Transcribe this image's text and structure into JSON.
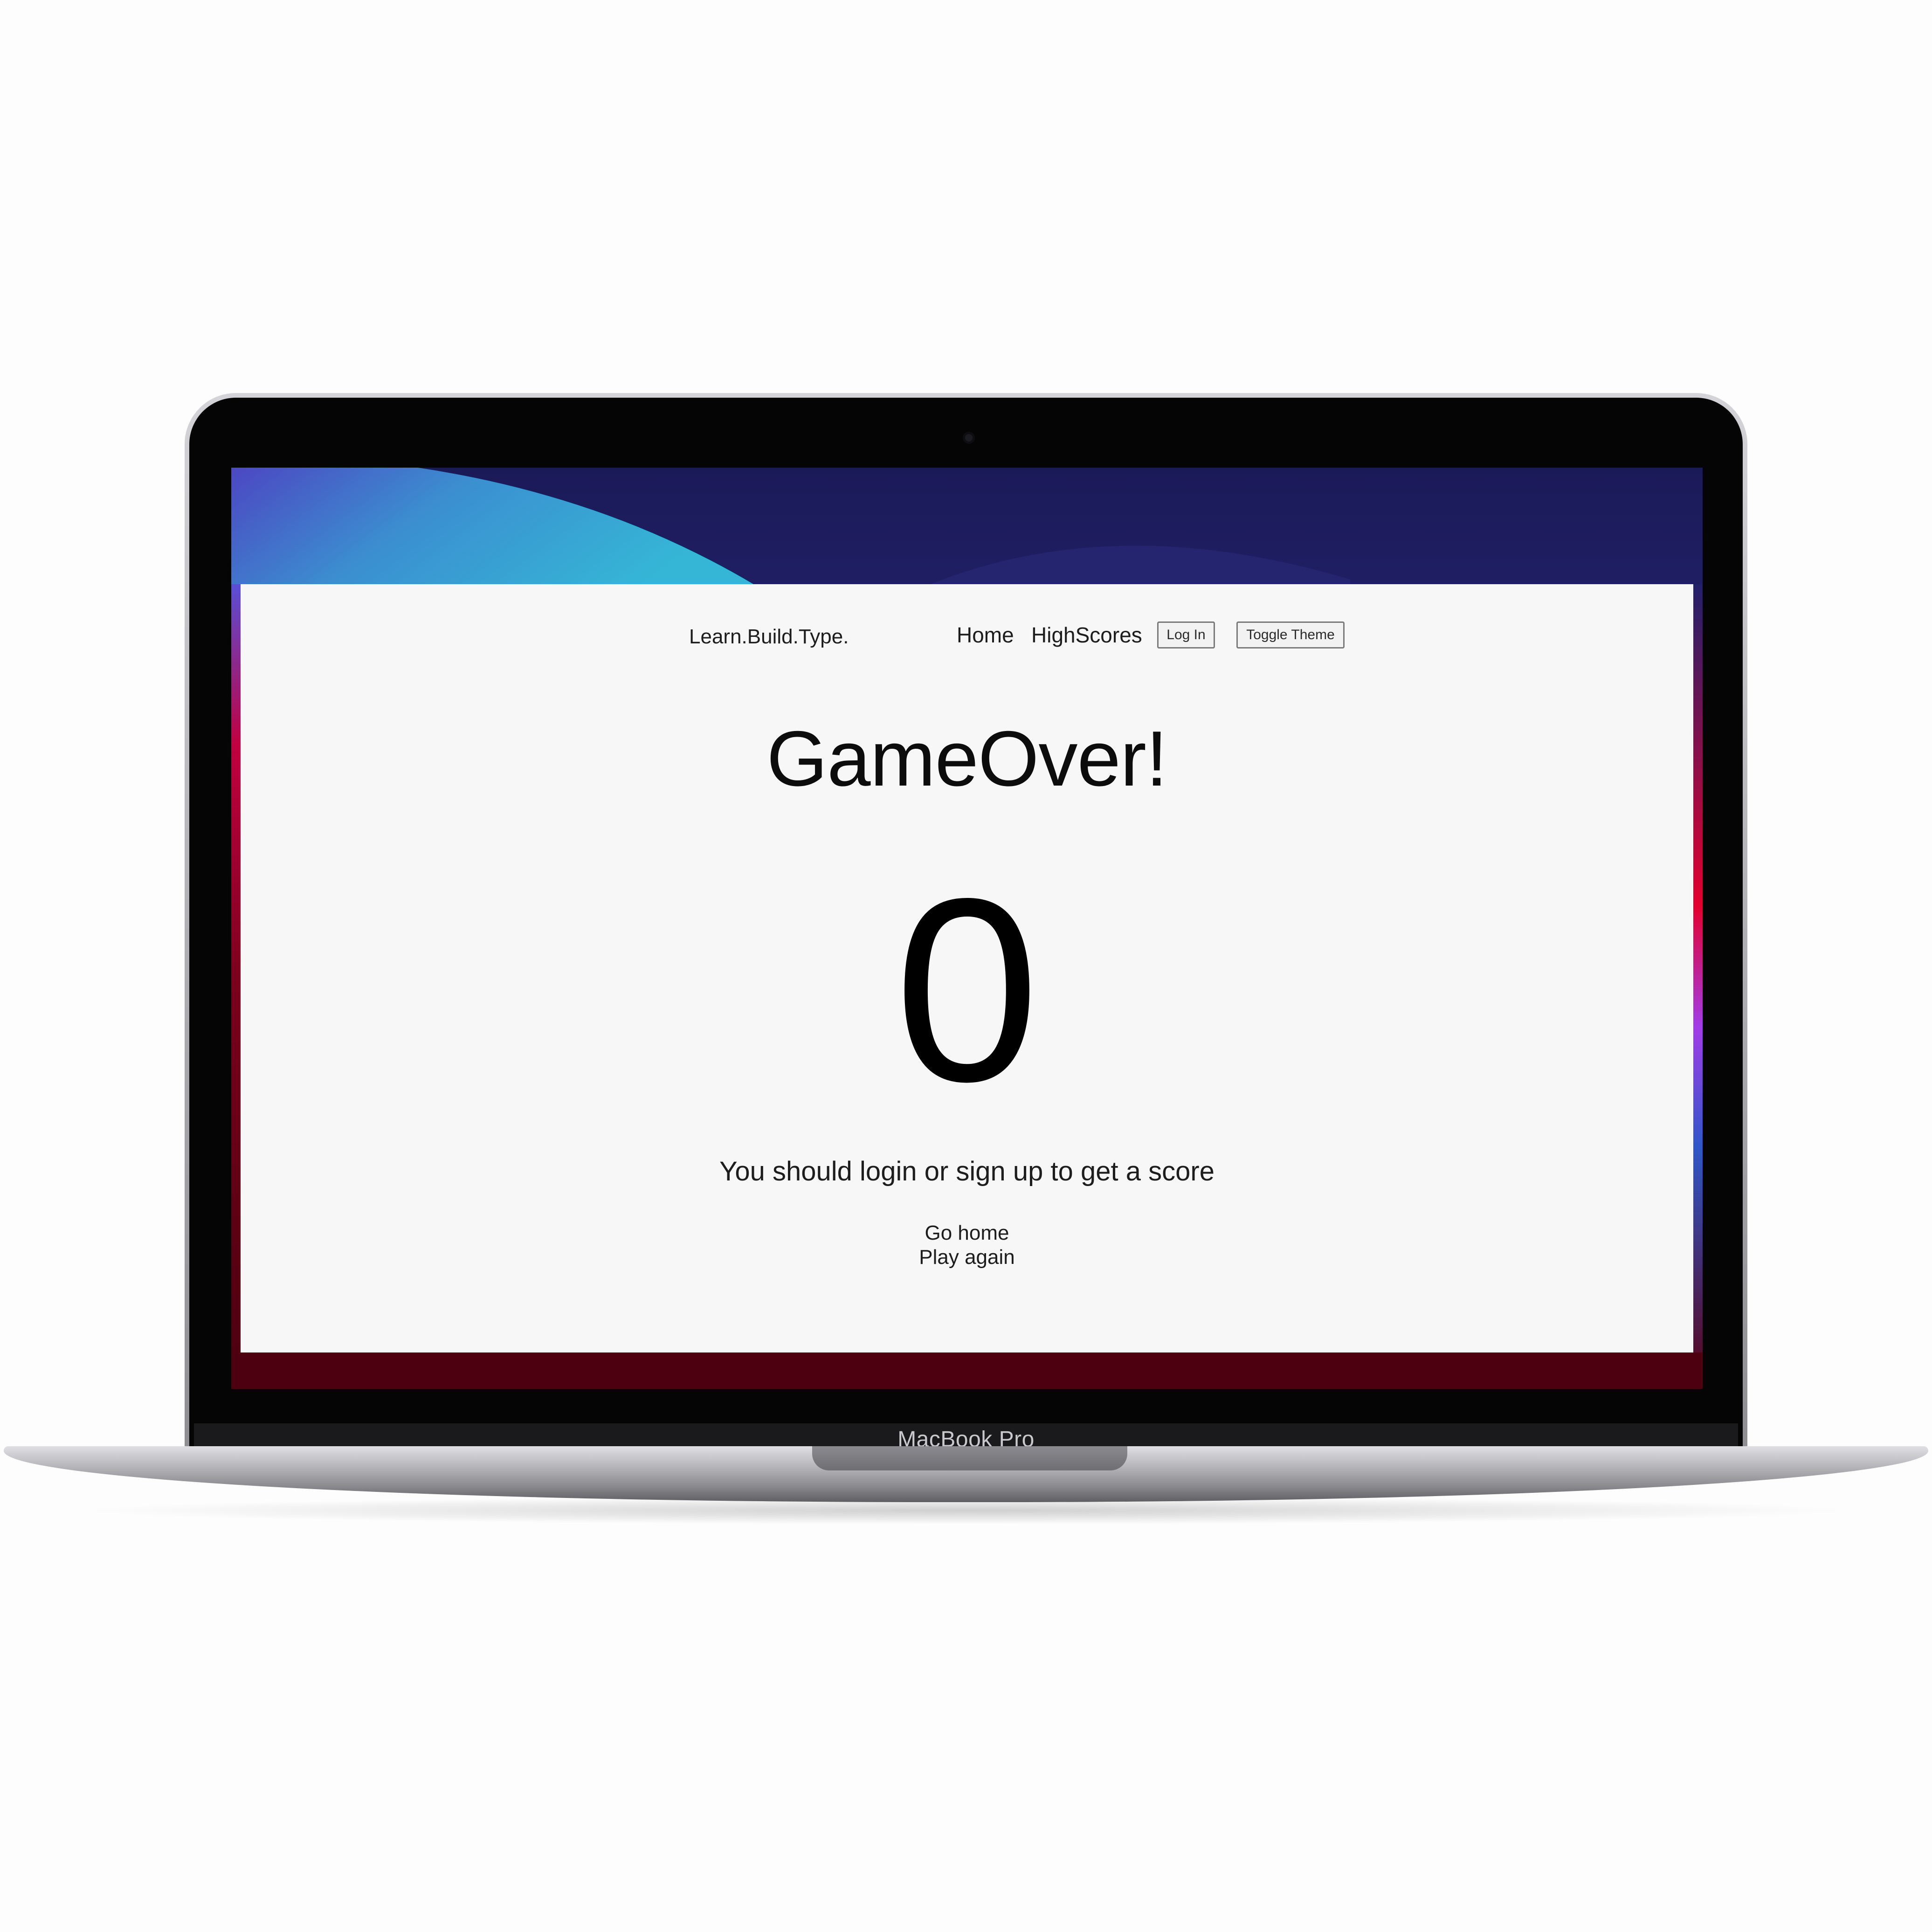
{
  "device": {
    "model_label": "MacBook Pro"
  },
  "nav": {
    "logo": "Learn.Build.Type.",
    "home_label": "Home",
    "highscores_label": "HighScores",
    "login_label": "Log In",
    "toggle_theme_label": "Toggle Theme"
  },
  "game": {
    "title": "GameOver!",
    "score": "0",
    "message": "You should login or sign up to get a score",
    "go_home_label": "Go home",
    "play_again_label": "Play again"
  },
  "colors": {
    "page_background": "#f7f7f7",
    "text": "#1d1d1d",
    "wallpaper_top": "#1f1e63",
    "wallpaper_bottom": "#4c0010"
  }
}
